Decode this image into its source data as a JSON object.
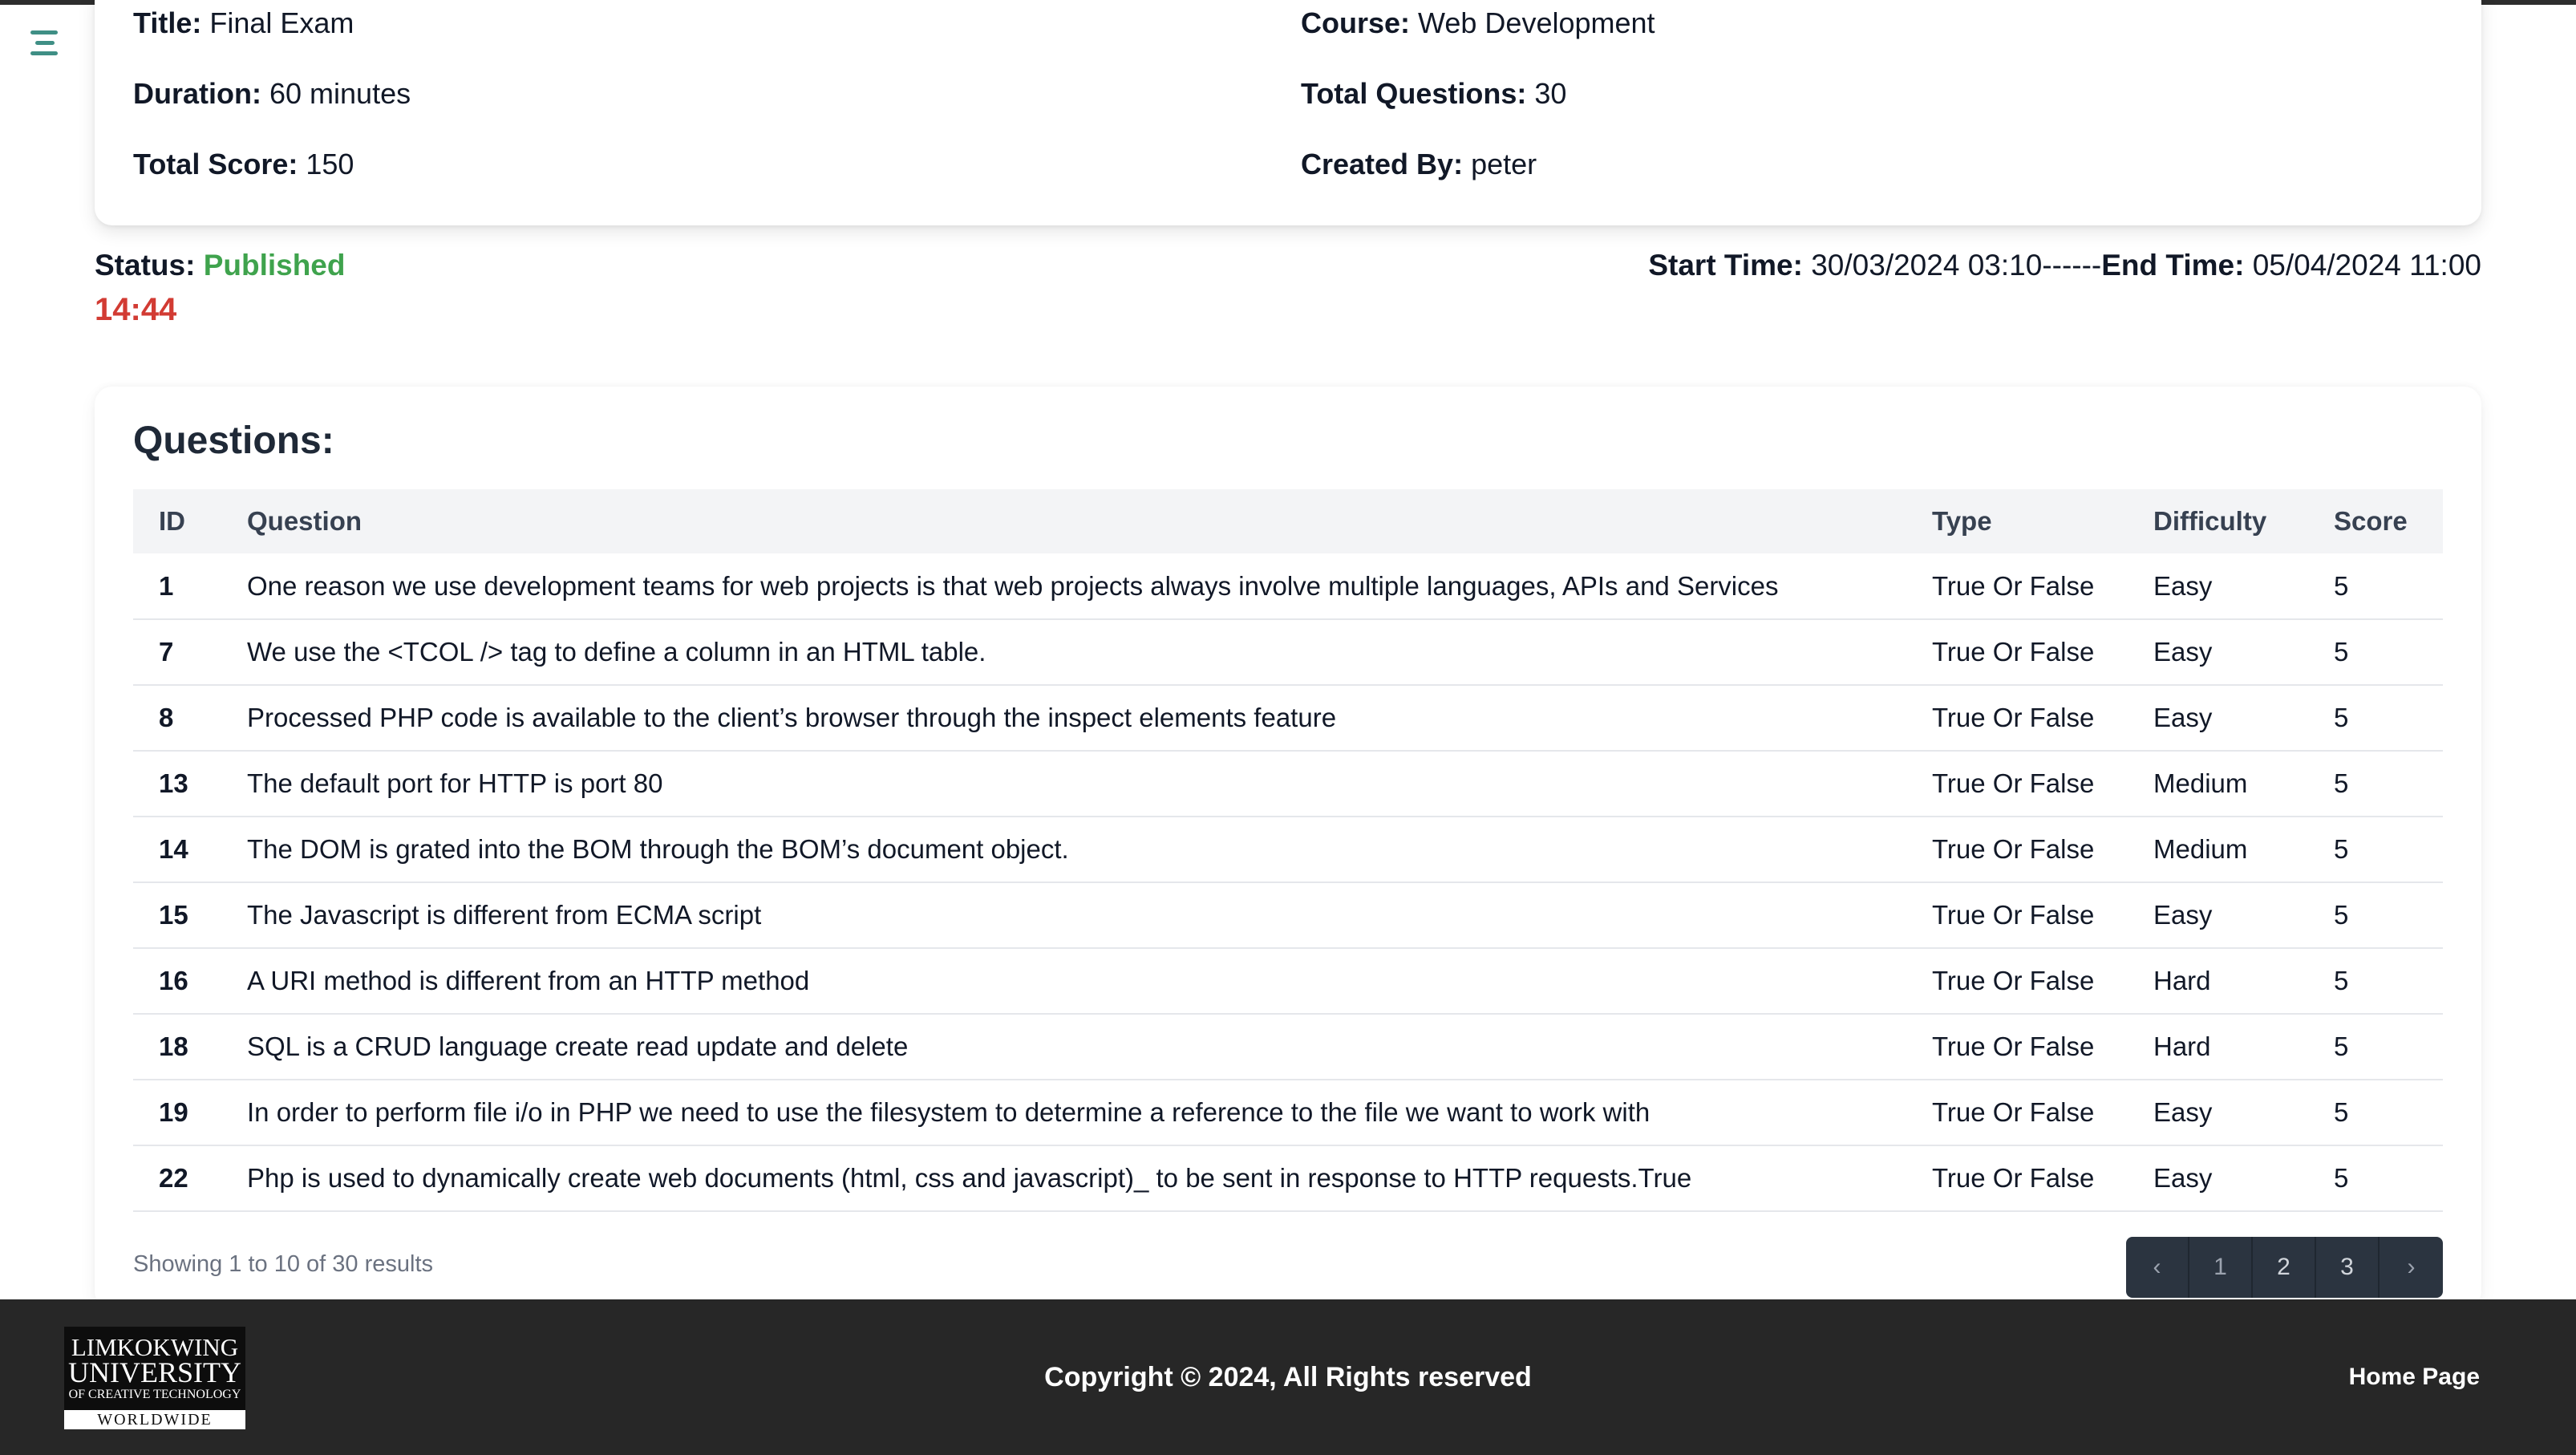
{
  "menu": {
    "icon": "hamburger-menu-icon"
  },
  "exam": {
    "title_label": "Title:",
    "title": "Final Exam",
    "course_label": "Course:",
    "course": "Web Development",
    "duration_label": "Duration:",
    "duration": "60 minutes",
    "total_questions_label": "Total Questions:",
    "total_questions": "30",
    "total_score_label": "Total Score:",
    "total_score": "150",
    "created_by_label": "Created By:",
    "created_by": "peter"
  },
  "status": {
    "label": "Status:",
    "value": "Published",
    "color": "#3fa34d",
    "timer": "14:44",
    "timer_color": "#d23b33",
    "start_label": "Start Time:",
    "start_time": "30/03/2024 03:10",
    "separator": "------",
    "end_label": "End Time:",
    "end_time": "05/04/2024 11:00"
  },
  "questions": {
    "heading": "Questions:",
    "columns": [
      "ID",
      "Question",
      "Type",
      "Difficulty",
      "Score"
    ],
    "rows": [
      {
        "id": "1",
        "question": "One reason we use development teams for web projects is that web projects always involve multiple languages, APIs and Services",
        "type": "True Or False",
        "difficulty": "Easy",
        "score": "5"
      },
      {
        "id": "7",
        "question": "We use the <TCOL /> tag to define a column in an HTML table.",
        "type": "True Or False",
        "difficulty": "Easy",
        "score": "5"
      },
      {
        "id": "8",
        "question": "Processed PHP code is available to the client’s browser through the inspect elements feature",
        "type": "True Or False",
        "difficulty": "Easy",
        "score": "5"
      },
      {
        "id": "13",
        "question": "The default port for HTTP is port 80",
        "type": "True Or False",
        "difficulty": "Medium",
        "score": "5"
      },
      {
        "id": "14",
        "question": "The DOM is grated into the BOM through the BOM’s document object.",
        "type": "True Or False",
        "difficulty": "Medium",
        "score": "5"
      },
      {
        "id": "15",
        "question": "The Javascript is different from ECMA script",
        "type": "True Or False",
        "difficulty": "Easy",
        "score": "5"
      },
      {
        "id": "16",
        "question": "A URI method is different from an HTTP method",
        "type": "True Or False",
        "difficulty": "Hard",
        "score": "5"
      },
      {
        "id": "18",
        "question": "SQL is a CRUD language create read update and delete",
        "type": "True Or False",
        "difficulty": "Hard",
        "score": "5"
      },
      {
        "id": "19",
        "question": "In order to perform file i/o in PHP we need to use the filesystem to determine a reference to the file we want to work with",
        "type": "True Or False",
        "difficulty": "Easy",
        "score": "5"
      },
      {
        "id": "22",
        "question": "Php is used to dynamically create web documents (html, css and javascript)_ to be sent in response to HTTP requests.True",
        "type": "True Or False",
        "difficulty": "Easy",
        "score": "5"
      }
    ],
    "results_text": "Showing 1 to 10 of 30 results",
    "pagination": {
      "prev_icon": "chevron-left-icon",
      "pages": [
        "1",
        "2",
        "3"
      ],
      "current": "1",
      "next_icon": "chevron-right-icon"
    }
  },
  "footer": {
    "logo": {
      "line1": "LIMKOKWING",
      "line2": "UNIVERSITY",
      "line3": "OF CREATIVE TECHNOLOGY",
      "line4": "WORLDWIDE"
    },
    "copyright": "Copyright © 2024, All Rights reserved",
    "home_link": "Home Page",
    "background": "#272727"
  }
}
